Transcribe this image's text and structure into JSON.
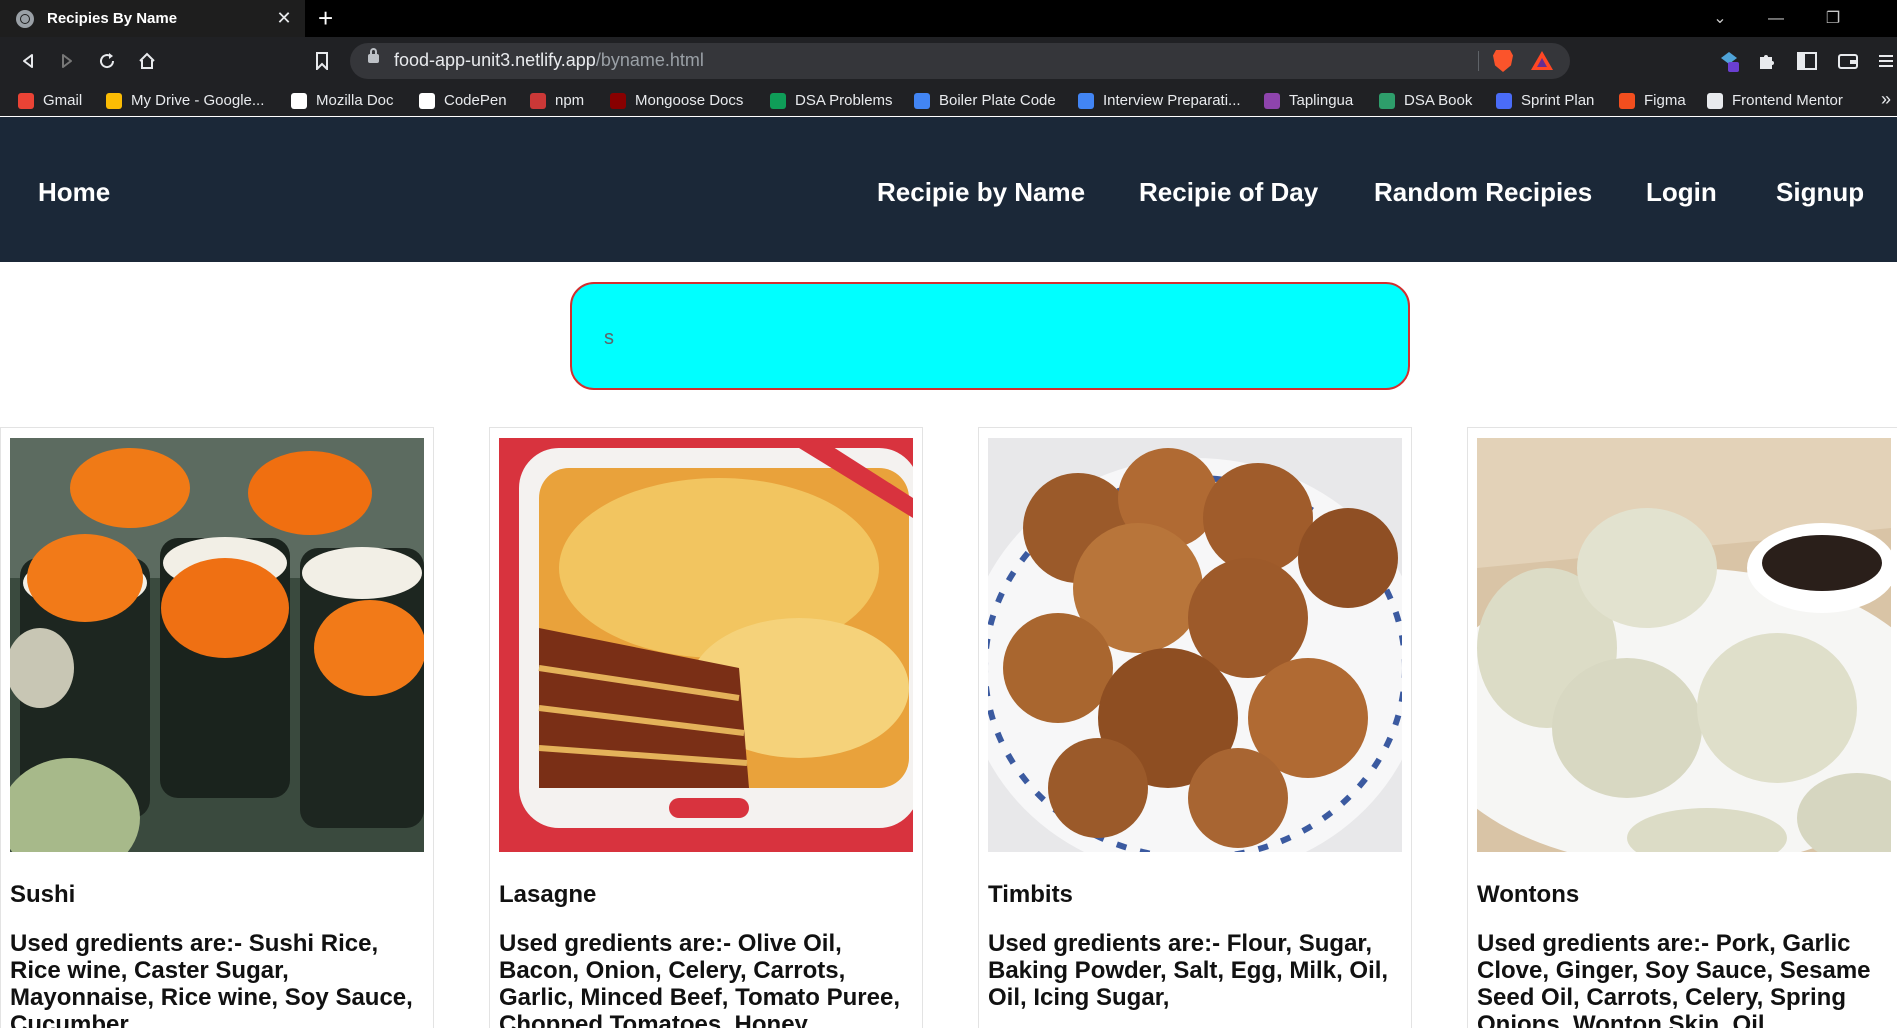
{
  "browser": {
    "tab_title": "Recipies By Name",
    "url_host": "food-app-unit3.netlify.app",
    "url_path": "/byname.html",
    "bookmarks": [
      {
        "label": "Gmail",
        "color": "#ea4335"
      },
      {
        "label": "My Drive - Google...",
        "color": "#fbbc04"
      },
      {
        "label": "Mozilla Doc",
        "color": "#ffffff"
      },
      {
        "label": "CodePen",
        "color": "#ffffff"
      },
      {
        "label": "npm",
        "color": "#cb3837"
      },
      {
        "label": "Mongoose Docs",
        "color": "#880000"
      },
      {
        "label": "DSA Problems",
        "color": "#0f9d58"
      },
      {
        "label": "Boiler Plate Code",
        "color": "#4285f4"
      },
      {
        "label": "Interview Preparati...",
        "color": "#4285f4"
      },
      {
        "label": "Taplingua",
        "color": "#8e44ad"
      },
      {
        "label": "DSA Book",
        "color": "#2e9e6b"
      },
      {
        "label": "Sprint Plan",
        "color": "#4a6cf7"
      },
      {
        "label": "Figma",
        "color": "#f24e1e"
      },
      {
        "label": "Frontend Mentor",
        "color": "#e8eaed"
      }
    ]
  },
  "nav": {
    "home": "Home",
    "by_name": "Recipie by Name",
    "of_day": "Recipie of Day",
    "random": "Random Recipies",
    "login": "Login",
    "signup": "Signup"
  },
  "search": {
    "value": "s",
    "bg_color": "#00ffff",
    "border_color": "#d32f2f"
  },
  "recipes": [
    {
      "name": "Sushi",
      "ingredients": "Used gredients are:- Sushi Rice, Rice wine, Caster Sugar, Mayonnaise, Rice wine, Soy Sauce, Cucumber"
    },
    {
      "name": "Lasagne",
      "ingredients": "Used gredients are:- Olive Oil, Bacon, Onion, Celery, Carrots, Garlic, Minced Beef, Tomato Puree, Chopped Tomatoes, Honey"
    },
    {
      "name": "Timbits",
      "ingredients": "Used gredients are:- Flour, Sugar, Baking Powder, Salt, Egg, Milk, Oil, Oil, Icing Sugar,"
    },
    {
      "name": "Wontons",
      "ingredients": "Used gredients are:- Pork, Garlic Clove, Ginger, Soy Sauce, Sesame Seed Oil, Carrots, Celery, Spring Onions, Wonton Skin, Oil"
    }
  ],
  "colors": {
    "navbar": "#1b2838",
    "nav_text": "#ffffff"
  }
}
